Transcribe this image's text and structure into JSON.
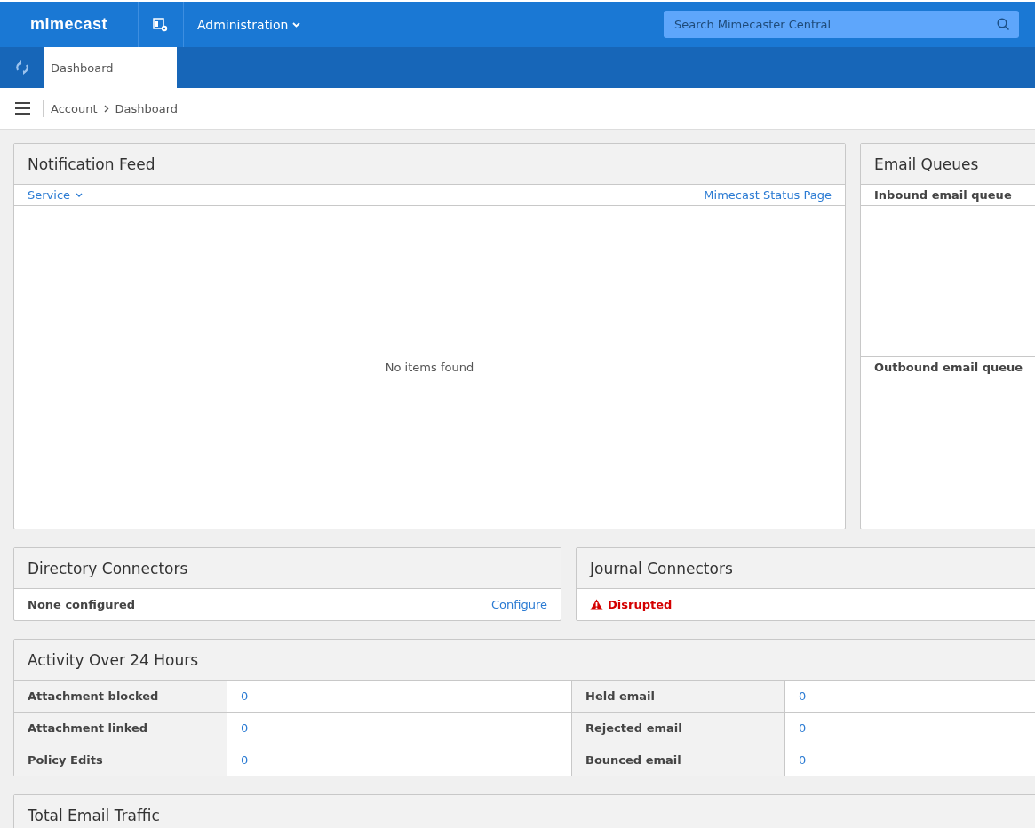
{
  "topbar": {
    "logo": "mimecast",
    "menu": "Administration",
    "search": {
      "placeholder": "Search Mimecaster Central"
    }
  },
  "tabs": [
    {
      "label": "Dashboard",
      "selected": true
    }
  ],
  "breadcrumb": [
    "Account",
    "Dashboard"
  ],
  "notification_feed": {
    "title": "Notification Feed",
    "filter": "Service",
    "link": "Mimecast Status Page",
    "empty": "No items found"
  },
  "email_queues": {
    "title": "Email Queues",
    "sections": [
      "Inbound email queue",
      "Outbound email queue"
    ]
  },
  "directory_connectors": {
    "title": "Directory Connectors",
    "status": {
      "kind": "plain",
      "text": "None configured"
    },
    "link": "Configure"
  },
  "journal_connectors": {
    "title": "Journal Connectors",
    "status": {
      "kind": "disrupted",
      "text": "Disrupted"
    }
  },
  "activity": {
    "title": "Activity Over 24 Hours",
    "rows": [
      {
        "label": "Attachment blocked",
        "value": "0",
        "label_2": "Held email",
        "value_2": "0"
      },
      {
        "label": "Attachment linked",
        "value": "0",
        "label_2": "Rejected email",
        "value_2": "0"
      },
      {
        "label": "Policy Edits",
        "value": "0",
        "label_2": "Bounced email",
        "value_2": "0"
      }
    ]
  },
  "total_email_traffic": {
    "title": "Total Email Traffic"
  }
}
